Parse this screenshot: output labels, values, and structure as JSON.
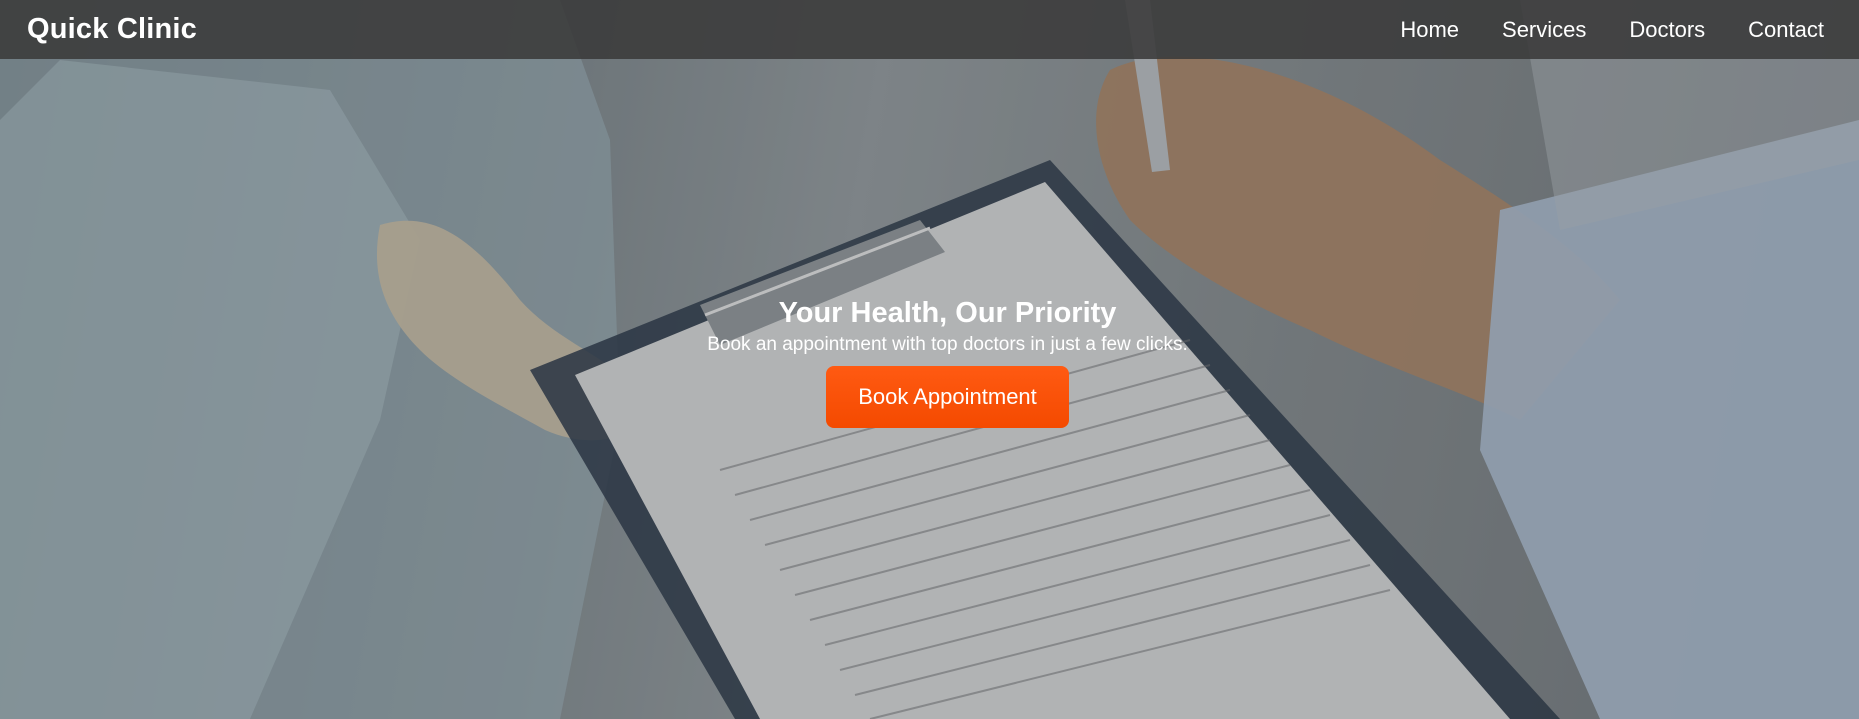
{
  "navbar": {
    "brand": "Quick Clinic",
    "links": [
      {
        "label": "Home"
      },
      {
        "label": "Services"
      },
      {
        "label": "Doctors"
      },
      {
        "label": "Contact"
      }
    ]
  },
  "hero": {
    "title": "Your Health, Our Priority",
    "subtitle": "Book an appointment with top doctors in just a few clicks.",
    "cta_label": "Book Appointment"
  },
  "colors": {
    "navbar_bg": "#3a3a3a",
    "cta_bg": "#ff5a12",
    "text": "#ffffff"
  }
}
